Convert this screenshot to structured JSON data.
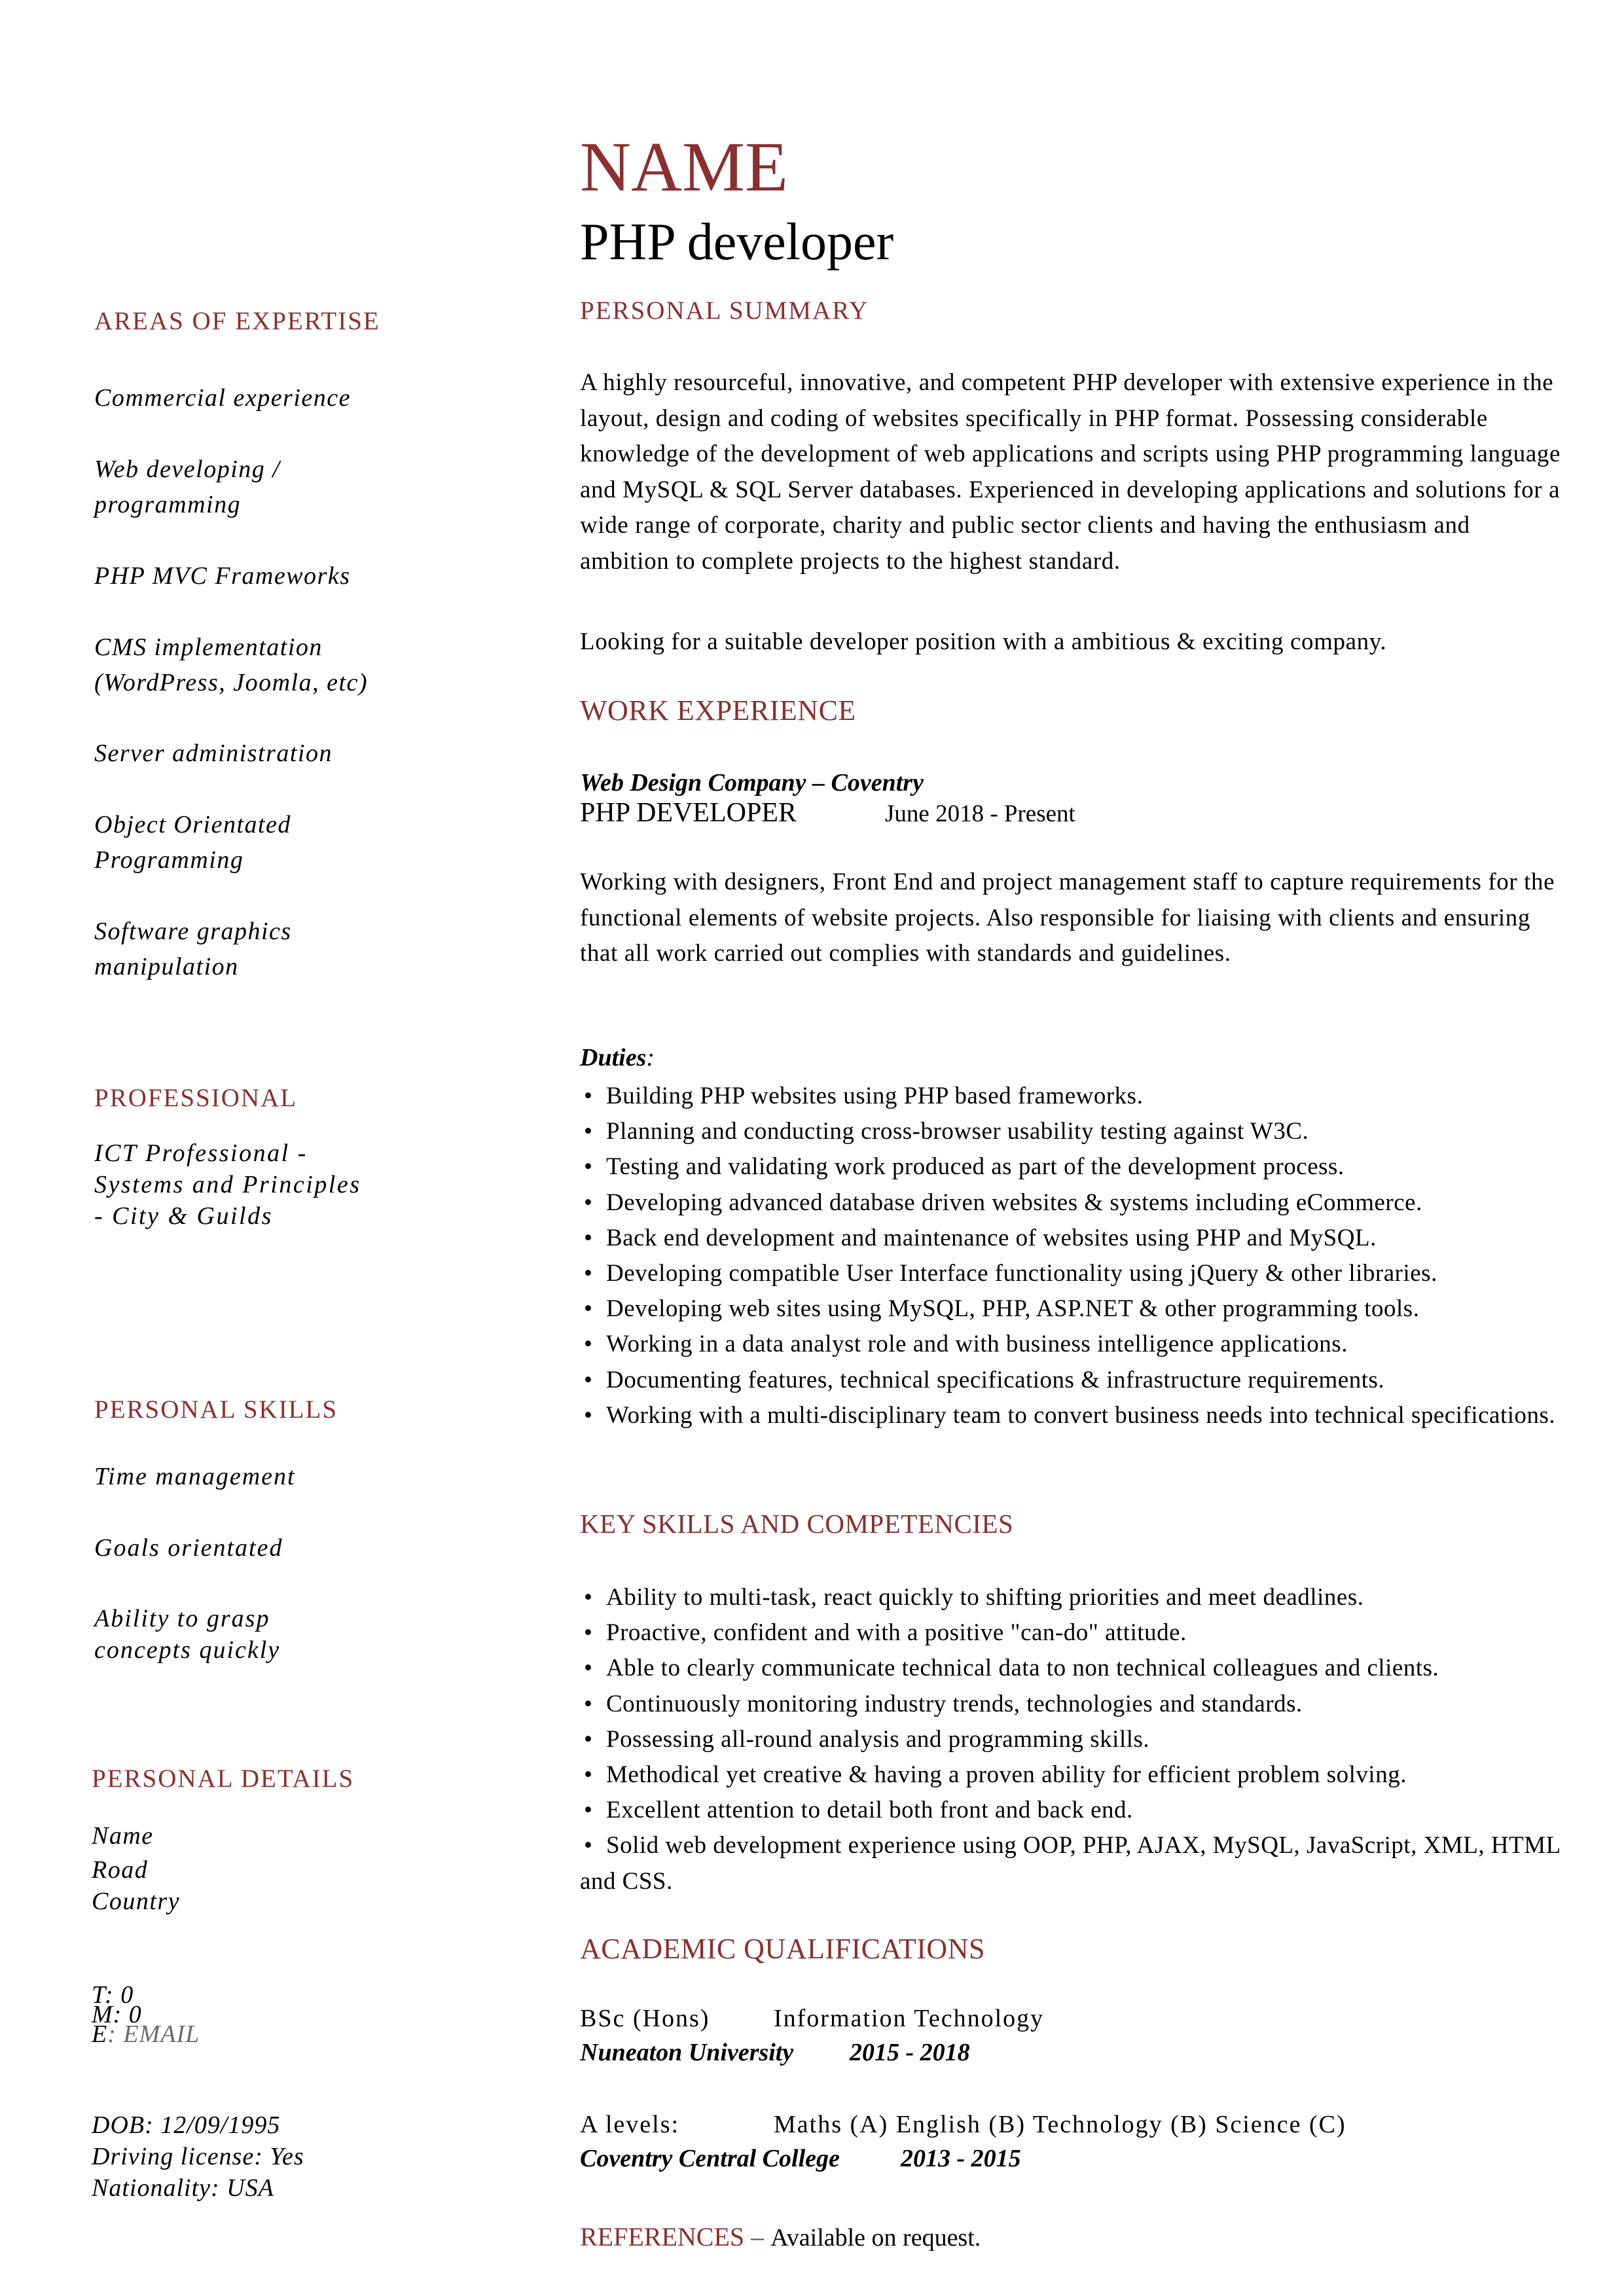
{
  "theme": {
    "accent_color": "#8b2f2f",
    "text_color": "#000000",
    "muted_color": "#6b6b6b"
  },
  "header": {
    "name": "NAME",
    "job_title": "PHP developer"
  },
  "sidebar": {
    "areas_of_expertise": {
      "title": "AREAS OF EXPERTISE",
      "items": [
        "Commercial experience",
        "Web developing /\nprogramming",
        "PHP MVC Frameworks",
        "CMS implementation\n(WordPress, Joomla, etc)",
        "Server administration",
        "Object Orientated\nProgramming",
        "Software graphics\nmanipulation"
      ]
    },
    "professional": {
      "title": "PROFESSIONAL",
      "text": "ICT Professional -\nSystems and Principles\n- City & Guilds"
    },
    "personal_skills": {
      "title": "PERSONAL SKILLS",
      "items": [
        "Time management",
        "Goals orientated",
        "Ability to grasp\nconcepts quickly"
      ]
    },
    "personal_details": {
      "title": "PERSONAL DETAILS",
      "address": [
        "Name",
        "Road",
        "Country"
      ],
      "phone_label": "T: 0",
      "mobile_label": "M: 0",
      "email_label": "E",
      "email_sep": ": ",
      "email_value": "EMAIL",
      "dob": "DOB: 12/09/1995",
      "driving_license": "Driving license:  Yes",
      "nationality": "Nationality: USA"
    }
  },
  "summary": {
    "title": "PERSONAL SUMMARY",
    "paragraph": "A highly resourceful, innovative, and competent PHP developer with extensive experience in the layout, design and coding of  websites specifically in PHP format. Possessing considerable knowledge of the development of web applications and scripts using PHP programming language and MySQL & SQL Server databases. Experienced in developing applications and solutions for a wide range of corporate, charity and public sector clients and having the enthusiasm and ambition to complete projects to the highest standard.",
    "objective": "Looking for a suitable developer position with a ambitious & exciting company."
  },
  "work_experience": {
    "title": "WORK EXPERIENCE",
    "jobs": [
      {
        "company": "Web Design Company – Coventry",
        "role": "PHP DEVELOPER",
        "dates": "June 2018 - Present",
        "description": "Working with designers, Front End and project management staff to capture requirements for the functional elements of website projects. Also responsible for liaising with clients and ensuring that all work carried out complies with standards and guidelines.",
        "duties_label": "Duties",
        "duties_colon": ":",
        "duties": [
          "Building PHP websites using PHP based frameworks.",
          "Planning and conducting cross-browser usability testing against W3C.",
          "Testing and validating work produced as part of the development process.",
          "Developing advanced database driven websites & systems including eCommerce.",
          "Back end development and maintenance of websites using PHP and MySQL.",
          "Developing compatible User Interface functionality using jQuery & other libraries.",
          "Developing web sites using MySQL, PHP, ASP.NET & other programming tools.",
          "Working in a data analyst role and with business intelligence applications.",
          "Documenting features, technical specifications & infrastructure requirements.",
          "Working with a multi-disciplinary team to convert business needs into technical specifications."
        ]
      }
    ]
  },
  "key_skills": {
    "title": "KEY SKILLS AND COMPETENCIES",
    "items": [
      "Ability to multi-task, react quickly to shifting priorities and meet deadlines.",
      "Proactive, confident and with a positive \"can-do\" attitude.",
      "Able to clearly communicate technical data to non technical colleagues and clients.",
      "Continuously monitoring industry trends, technologies and standards.",
      "Possessing all-round analysis and programming skills.",
      "Methodical yet creative & having a proven ability for efficient problem solving.",
      "Excellent attention to detail both front and back end.",
      "Solid web development experience using OOP, PHP, AJAX, MySQL, JavaScript, XML, HTML and CSS."
    ]
  },
  "academic": {
    "title": "ACADEMIC QUALIFICATIONS",
    "qualifications": [
      {
        "level": "BSc (Hons)",
        "subject": "Information Technology",
        "institution": "Nuneaton University",
        "years": "2015 - 2018"
      },
      {
        "level": "A levels:",
        "subject": "Maths (A) English (B) Technology (B) Science (C)",
        "institution": "Coventry Central College",
        "years": "2013 - 2015"
      }
    ]
  },
  "references": {
    "title": "REFERENCES",
    "separator": " – ",
    "text": "Available on request."
  },
  "icons": {
    "bullet": "•"
  }
}
